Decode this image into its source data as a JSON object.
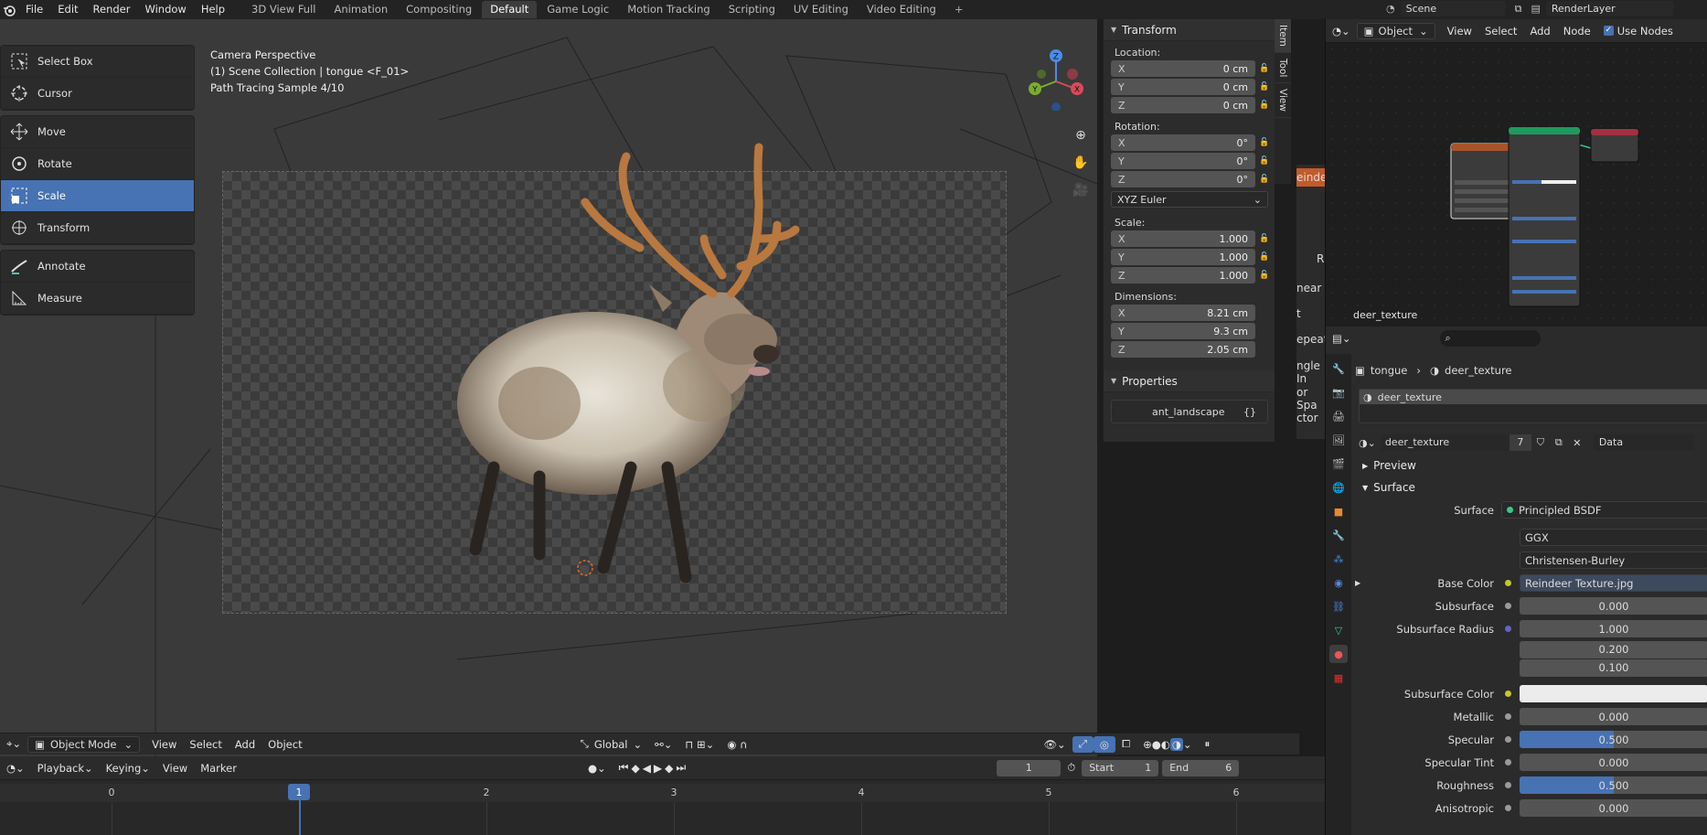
{
  "app": {
    "menu": [
      "File",
      "Edit",
      "Render",
      "Window",
      "Help"
    ],
    "workspaces": [
      "3D View Full",
      "Animation",
      "Compositing",
      "Default",
      "Game Logic",
      "Motion Tracking",
      "Scripting",
      "UV Editing",
      "Video Editing"
    ],
    "active_workspace": "Default",
    "scene": "Scene",
    "view_layer": "RenderLayer"
  },
  "viewport": {
    "overlay_lines": [
      "Camera Perspective",
      "(1) Scene Collection | tongue <F_01>",
      "Path Tracing Sample 4/10"
    ],
    "tools": [
      {
        "label": "Select Box",
        "icon": "select-box-icon"
      },
      {
        "label": "Cursor",
        "icon": "cursor-icon"
      },
      {
        "label": "Move",
        "icon": "move-icon"
      },
      {
        "label": "Rotate",
        "icon": "rotate-icon"
      },
      {
        "label": "Scale",
        "icon": "scale-icon",
        "active": true
      },
      {
        "label": "Transform",
        "icon": "transform-icon"
      },
      {
        "label": "Annotate",
        "icon": "annotate-icon"
      },
      {
        "label": "Measure",
        "icon": "measure-icon"
      }
    ],
    "gizmo_labels": {
      "x": "X",
      "y": "Y",
      "z": "Z"
    },
    "header": {
      "mode": "Object Mode",
      "menus": [
        "View",
        "Select",
        "Add",
        "Object"
      ],
      "orientation": "Global"
    }
  },
  "npanel": {
    "tabs": [
      "Item",
      "Tool",
      "View"
    ],
    "transform_title": "Transform",
    "location_label": "Location:",
    "location": [
      {
        "axis": "X",
        "value": "0 cm"
      },
      {
        "axis": "Y",
        "value": "0 cm"
      },
      {
        "axis": "Z",
        "value": "0 cm"
      }
    ],
    "rotation_label": "Rotation:",
    "rotation": [
      {
        "axis": "X",
        "value": "0°"
      },
      {
        "axis": "Y",
        "value": "0°"
      },
      {
        "axis": "Z",
        "value": "0°"
      }
    ],
    "rotation_mode": "XYZ Euler",
    "scale_label": "Scale:",
    "scale": [
      {
        "axis": "X",
        "value": "1.000"
      },
      {
        "axis": "Y",
        "value": "1.000"
      },
      {
        "axis": "Z",
        "value": "1.000"
      }
    ],
    "dimensions_label": "Dimensions:",
    "dimensions": [
      {
        "axis": "X",
        "value": "8.21 cm"
      },
      {
        "axis": "Y",
        "value": "9.3 cm"
      },
      {
        "axis": "Z",
        "value": "2.05 cm"
      }
    ],
    "properties_title": "Properties",
    "property_name": "ant_landscape",
    "property_value": "{}"
  },
  "partial_panel_text": [
    "eindee",
    "R",
    "near",
    "t",
    "epeat",
    "ngle In",
    "or Spa",
    "ctor"
  ],
  "timeline": {
    "menus": [
      "Playback",
      "Keying",
      "View",
      "Marker"
    ],
    "current_frame": "1",
    "start_label": "Start",
    "start": "1",
    "end_label": "End",
    "end": "6",
    "ruler": [
      "0",
      "1",
      "2",
      "3",
      "4",
      "5",
      "6"
    ]
  },
  "node_editor": {
    "type": "Object",
    "menus": [
      "View",
      "Select",
      "Add",
      "Node"
    ],
    "use_nodes": "Use Nodes",
    "material_name": "deer_texture"
  },
  "properties": {
    "breadcrumb_object": "tongue",
    "breadcrumb_material": "deer_texture",
    "slot": "deer_texture",
    "material": "deer_texture",
    "users": "7",
    "link": "Data",
    "sections": {
      "preview": "Preview",
      "surface": "Surface"
    },
    "surface_label": "Surface",
    "surface_shader": "Principled BSDF",
    "distribution": "GGX",
    "subsurface_method": "Christensen-Burley",
    "rows": [
      {
        "label": "Base Color",
        "value": "Reindeer Texture.jpg",
        "socket": "#c7c729"
      },
      {
        "label": "Subsurface",
        "value": "0.000",
        "socket": "#a1a1a1"
      },
      {
        "label": "Subsurface Radius",
        "values": [
          "1.000",
          "0.200",
          "0.100"
        ],
        "socket": "#6363c7"
      },
      {
        "label": "Subsurface Color",
        "socket": "#c7c729"
      },
      {
        "label": "Metallic",
        "value": "0.000",
        "socket": "#a1a1a1"
      },
      {
        "label": "Specular",
        "value": "0.500",
        "fill": 0.5,
        "socket": "#a1a1a1"
      },
      {
        "label": "Specular Tint",
        "value": "0.000",
        "socket": "#a1a1a1"
      },
      {
        "label": "Roughness",
        "value": "0.500",
        "fill": 0.5,
        "socket": "#a1a1a1"
      },
      {
        "label": "Anisotropic",
        "value": "0.000",
        "socket": "#a1a1a1"
      }
    ]
  }
}
